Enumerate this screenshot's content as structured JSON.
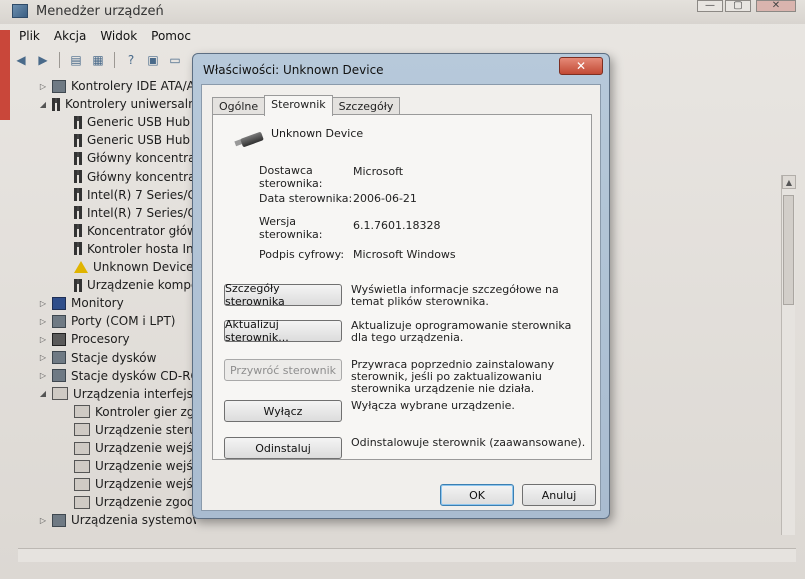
{
  "app": {
    "title": "Menedżer urządzeń",
    "window_controls": {
      "minimize": "—",
      "maximize": "▢",
      "close": "✕"
    }
  },
  "menu": [
    "Plik",
    "Akcja",
    "Widok",
    "Pomoc"
  ],
  "toolbar_icons": [
    "back-arrow-icon",
    "forward-arrow-icon",
    "properties-icon",
    "list-icon",
    "help-icon",
    "view-icon",
    "monitor-icon"
  ],
  "tree": [
    {
      "label": "Kontrolery IDE ATA/AT",
      "icon": "controller-icon",
      "expander": "▷",
      "level": 1
    },
    {
      "label": "Kontrolery uniwersalne",
      "icon": "usb-icon",
      "expander": "◢",
      "level": 1
    },
    {
      "label": "Generic USB Hub",
      "icon": "usb-icon",
      "expander": "",
      "level": 2
    },
    {
      "label": "Generic USB Hub",
      "icon": "usb-icon",
      "expander": "",
      "level": 2
    },
    {
      "label": "Główny koncentrat",
      "icon": "usb-icon",
      "expander": "",
      "level": 2
    },
    {
      "label": "Główny koncentrat",
      "icon": "usb-icon",
      "expander": "",
      "level": 2
    },
    {
      "label": "Intel(R) 7 Series/C2",
      "icon": "usb-icon",
      "expander": "",
      "level": 2
    },
    {
      "label": "Intel(R) 7 Series/C2",
      "icon": "usb-icon",
      "expander": "",
      "level": 2
    },
    {
      "label": "Koncentrator głów",
      "icon": "usb-icon",
      "expander": "",
      "level": 2
    },
    {
      "label": "Kontroler hosta Int",
      "icon": "usb-icon",
      "expander": "",
      "level": 2
    },
    {
      "label": "Unknown Device",
      "icon": "warning-icon",
      "expander": "",
      "level": 2
    },
    {
      "label": "Urządzenie kompo",
      "icon": "usb-icon",
      "expander": "",
      "level": 2
    },
    {
      "label": "Monitory",
      "icon": "monitor-icon",
      "expander": "▷",
      "level": 1
    },
    {
      "label": "Porty (COM i LPT)",
      "icon": "port-icon",
      "expander": "▷",
      "level": 1
    },
    {
      "label": "Procesory",
      "icon": "cpu-icon",
      "expander": "▷",
      "level": 1
    },
    {
      "label": "Stacje dysków",
      "icon": "disk-icon",
      "expander": "▷",
      "level": 1
    },
    {
      "label": "Stacje dysków CD-ROM",
      "icon": "cdrom-icon",
      "expander": "▷",
      "level": 1
    },
    {
      "label": "Urządzenia interfejsu H",
      "icon": "hid-icon",
      "expander": "◢",
      "level": 1
    },
    {
      "label": "Kontroler gier zgod",
      "icon": "hid-icon",
      "expander": "",
      "level": 2
    },
    {
      "label": "Urządzenie sterując",
      "icon": "hid-icon",
      "expander": "",
      "level": 2
    },
    {
      "label": "Urządzenie wejścio",
      "icon": "hid-icon",
      "expander": "",
      "level": 2
    },
    {
      "label": "Urządzenie wejścio",
      "icon": "hid-icon",
      "expander": "",
      "level": 2
    },
    {
      "label": "Urządzenie wejścio",
      "icon": "hid-icon",
      "expander": "",
      "level": 2
    },
    {
      "label": "Urządzenie zgodne",
      "icon": "hid-icon",
      "expander": "",
      "level": 2
    },
    {
      "label": "Urządzenia systemowe",
      "icon": "system-icon",
      "expander": "▷",
      "level": 1
    }
  ],
  "dialog": {
    "title": "Właściwości: Unknown Device",
    "close": "✕",
    "tabs": [
      "Ogólne",
      "Sterownik",
      "Szczegóły"
    ],
    "active_tab": "Sterownik",
    "device_name": "Unknown Device",
    "info": [
      {
        "label_line1": "Dostawca",
        "label_line2": "sterownika:",
        "value": "Microsoft"
      },
      {
        "label_line1": "Data sterownika:",
        "label_line2": "",
        "value": "2006-06-21"
      },
      {
        "label_line1": "Wersja",
        "label_line2": "sterownika:",
        "value": "6.1.7601.18328"
      },
      {
        "label_line1": "Podpis cyfrowy:",
        "label_line2": "",
        "value": "Microsoft Windows"
      }
    ],
    "actions": [
      {
        "label": "Szczegóły sterownika",
        "desc": "Wyświetla informacje szczegółowe na temat plików sterownika.",
        "enabled": true
      },
      {
        "label": "Aktualizuj sterownik...",
        "desc": "Aktualizuje oprogramowanie sterownika dla tego urządzenia.",
        "enabled": true
      },
      {
        "label": "Przywróć sterownik",
        "desc": "Przywraca poprzednio zainstalowany sterownik, jeśli po zaktualizowaniu sterownika urządzenie nie działa.",
        "enabled": false
      },
      {
        "label": "Wyłącz",
        "desc": "Wyłącza wybrane urządzenie.",
        "enabled": true
      },
      {
        "label": "Odinstaluj",
        "desc": "Odinstalowuje sterownik (zaawansowane).",
        "enabled": true
      }
    ],
    "ok_label": "OK",
    "cancel_label": "Anuluj"
  }
}
